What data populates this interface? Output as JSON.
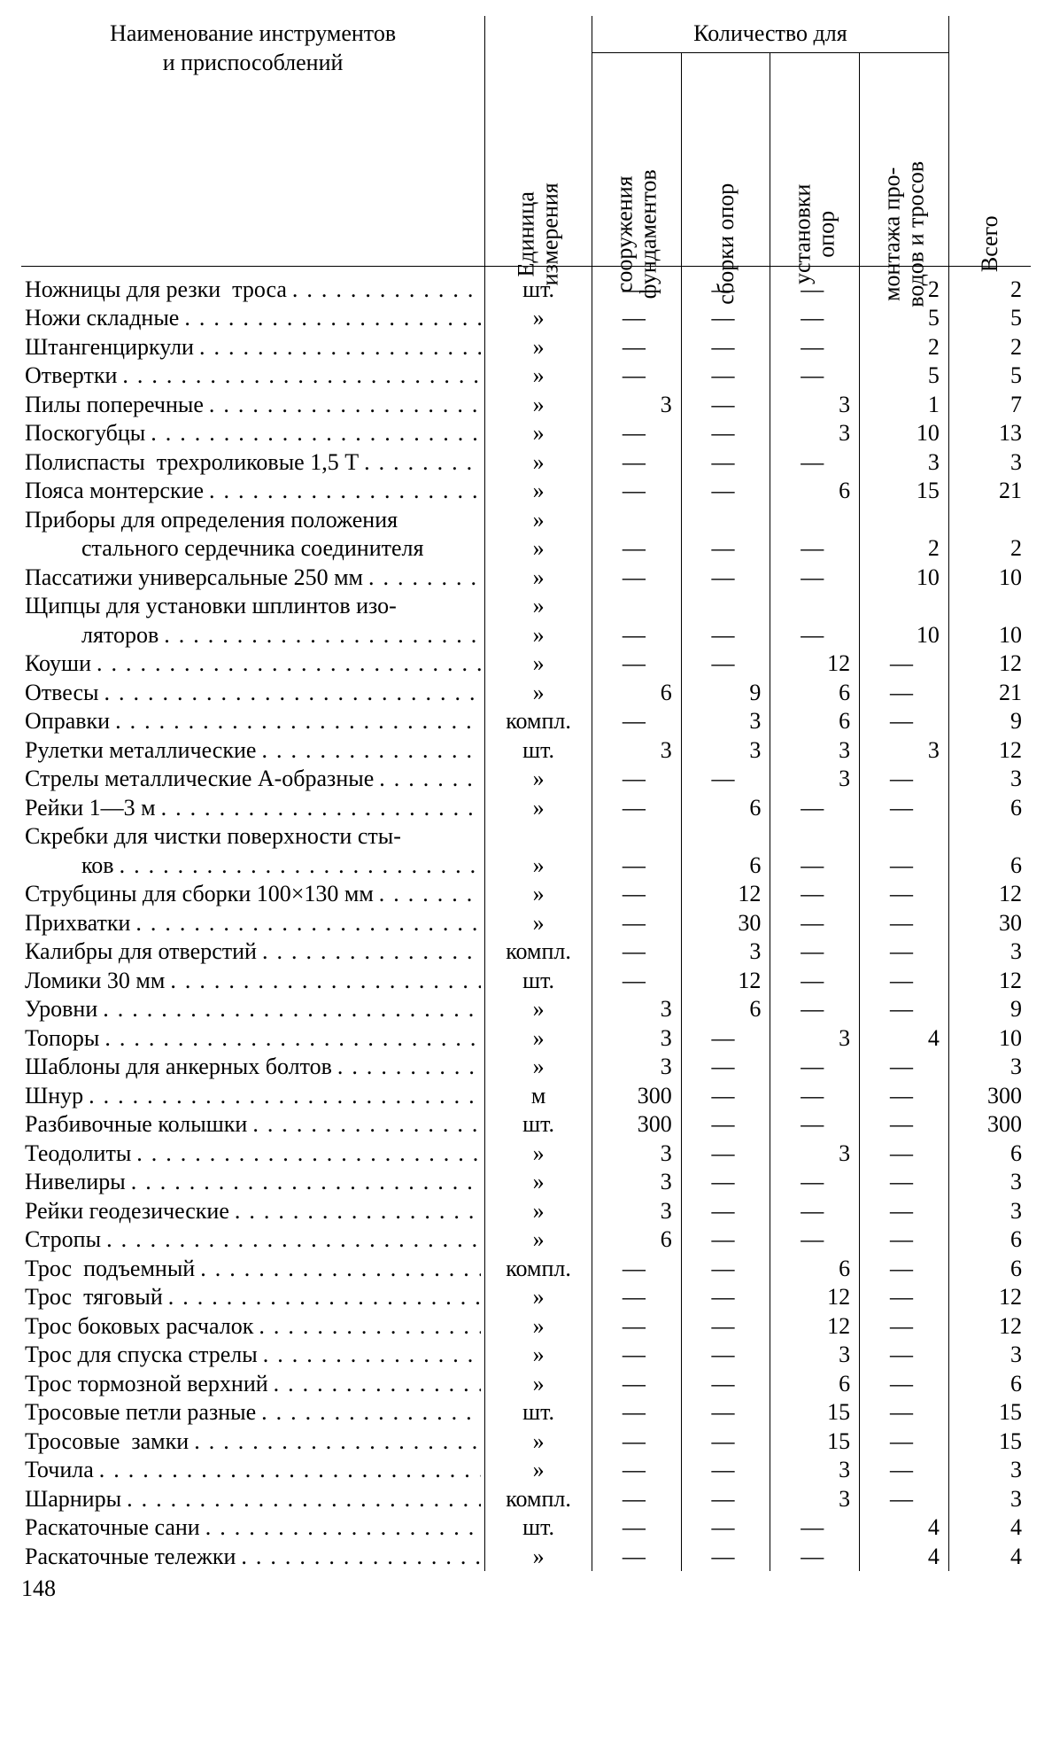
{
  "page_number": "148",
  "header": {
    "name": "Наименование инструментов\nи приспособлений",
    "unit": "Единица\nизмерения",
    "group": "Количество для",
    "cols": [
      "сооружения\nфундаментов",
      "сборки опор",
      "установки\nопор",
      "монтажа про-\nводов и тросов"
    ],
    "total": "Всего"
  },
  "units": {
    "sht": "шт.",
    "ditto": "»",
    "kompl": "компл.",
    "m": "м"
  },
  "rows": [
    {
      "n": "Ножницы для резки  троса",
      "u": "sht",
      "q": [
        "",
        "",
        "",
        "2"
      ],
      "t": "2",
      "dots": true
    },
    {
      "n": "Ножи складные",
      "u": "ditto",
      "q": [
        "",
        "",
        "",
        "5"
      ],
      "t": "5",
      "dots": true
    },
    {
      "n": "Штангенциркули",
      "u": "ditto",
      "q": [
        "",
        "",
        "",
        "2"
      ],
      "t": "2",
      "dots": true
    },
    {
      "n": "Отвертки",
      "u": "ditto",
      "q": [
        "",
        "",
        "",
        "5"
      ],
      "t": "5",
      "dots": true
    },
    {
      "n": "Пилы поперечные",
      "u": "ditto",
      "q": [
        "3",
        "",
        "3",
        "1"
      ],
      "t": "7",
      "dots": true
    },
    {
      "n": "Поскогубцы",
      "u": "ditto",
      "q": [
        "",
        "",
        "3",
        "10"
      ],
      "t": "13",
      "dots": true
    },
    {
      "n": "Полиспасты  трехроликовые 1,5 Т",
      "u": "ditto",
      "q": [
        "",
        "",
        "",
        "3"
      ],
      "t": "3",
      "dots": true
    },
    {
      "n": "Пояса монтерские",
      "u": "ditto",
      "q": [
        "",
        "",
        "6",
        "15"
      ],
      "t": "21",
      "dots": true
    },
    {
      "n": "Приборы для определения положения",
      "u": "ditto",
      "q": [
        null,
        null,
        null,
        null
      ],
      "t": null,
      "dots": false
    },
    {
      "n": "стального сердечника соединителя",
      "indent": true,
      "u": "ditto",
      "q": [
        "",
        "",
        "",
        "2"
      ],
      "t": "2",
      "dots": false
    },
    {
      "n": "Пассатижи универсальные 250 мм",
      "u": "ditto",
      "q": [
        "",
        "",
        "",
        "10"
      ],
      "t": "10",
      "dots": true
    },
    {
      "n": "Щипцы для установки шплинтов изо-",
      "u": "ditto",
      "q": [
        null,
        null,
        null,
        null
      ],
      "t": null,
      "dots": false
    },
    {
      "n": "ляторов",
      "indent": true,
      "u": "ditto",
      "q": [
        "",
        "",
        "",
        "10"
      ],
      "t": "10",
      "dots": true
    },
    {
      "n": "Коуши",
      "u": "ditto",
      "q": [
        "",
        "",
        "12",
        ""
      ],
      "t": "12",
      "dots": true
    },
    {
      "n": "Отвесы",
      "u": "ditto",
      "q": [
        "6",
        "9",
        "6",
        ""
      ],
      "t": "21",
      "dots": true
    },
    {
      "n": "Оправки",
      "u": "kompl",
      "q": [
        "",
        "3",
        "6",
        ""
      ],
      "t": "9",
      "dots": true
    },
    {
      "n": "Рулетки металлические",
      "u": "sht",
      "q": [
        "3",
        "3",
        "3",
        "3"
      ],
      "t": "12",
      "dots": true
    },
    {
      "n": "Стрелы металлические А-образные",
      "u": "ditto",
      "q": [
        "",
        "",
        "3",
        ""
      ],
      "t": "3",
      "dots": true
    },
    {
      "n": "Рейки 1—3 м",
      "u": "ditto",
      "q": [
        "",
        "6",
        "",
        ""
      ],
      "t": "6",
      "dots": true
    },
    {
      "n": "Скребки для чистки поверхности сты-",
      "u": null,
      "q": [
        null,
        null,
        null,
        null
      ],
      "t": null,
      "dots": false
    },
    {
      "n": "ков",
      "indent": true,
      "u": "ditto",
      "q": [
        "",
        "6",
        "",
        ""
      ],
      "t": "6",
      "dots": true
    },
    {
      "n": "Струбцины для сборки 100×130 мм",
      "u": "ditto",
      "q": [
        "",
        "12",
        "",
        ""
      ],
      "t": "12",
      "dots": true
    },
    {
      "n": "Прихватки",
      "u": "ditto",
      "q": [
        "",
        "30",
        "",
        ""
      ],
      "t": "30",
      "dots": true
    },
    {
      "n": "Калибры для отверстий",
      "u": "kompl",
      "q": [
        "",
        "3",
        "",
        ""
      ],
      "t": "3",
      "dots": true
    },
    {
      "n": "Ломики 30 мм",
      "u": "sht",
      "q": [
        "",
        "12",
        "",
        ""
      ],
      "t": "12",
      "dots": true
    },
    {
      "n": "Уровни",
      "u": "ditto",
      "q": [
        "3",
        "6",
        "",
        ""
      ],
      "t": "9",
      "dots": true
    },
    {
      "n": "Топоры",
      "u": "ditto",
      "q": [
        "3",
        "",
        "3",
        "4"
      ],
      "t": "10",
      "dots": true
    },
    {
      "n": "Шаблоны для анкерных болтов",
      "u": "ditto",
      "q": [
        "3",
        "",
        "",
        ""
      ],
      "t": "3",
      "dots": true
    },
    {
      "n": "Шнур",
      "u": "m",
      "q": [
        "300",
        "",
        "",
        ""
      ],
      "t": "300",
      "dots": true
    },
    {
      "n": "Разбивочные колышки",
      "u": "sht",
      "q": [
        "300",
        "",
        "",
        ""
      ],
      "t": "300",
      "dots": true
    },
    {
      "n": "Теодолиты",
      "u": "ditto",
      "q": [
        "3",
        "",
        "3",
        ""
      ],
      "t": "6",
      "dots": true
    },
    {
      "n": "Нивелиры",
      "u": "ditto",
      "q": [
        "3",
        "",
        "",
        ""
      ],
      "t": "3",
      "dots": true
    },
    {
      "n": "Рейки геодезические",
      "u": "ditto",
      "q": [
        "3",
        "",
        "",
        ""
      ],
      "t": "3",
      "dots": true
    },
    {
      "n": "Стропы",
      "u": "ditto",
      "q": [
        "6",
        "",
        "",
        ""
      ],
      "t": "6",
      "dots": true
    },
    {
      "n": "Трос  подъемный",
      "u": "kompl",
      "q": [
        "",
        "",
        "6",
        ""
      ],
      "t": "6",
      "dots": true
    },
    {
      "n": "Трос  тяговый",
      "u": "ditto",
      "q": [
        "",
        "",
        "12",
        ""
      ],
      "t": "12",
      "dots": true
    },
    {
      "n": "Трос боковых расчалок",
      "u": "ditto",
      "q": [
        "",
        "",
        "12",
        ""
      ],
      "t": "12",
      "dots": true
    },
    {
      "n": "Трос для спуска стрелы",
      "u": "ditto",
      "q": [
        "",
        "",
        "3",
        ""
      ],
      "t": "3",
      "dots": true
    },
    {
      "n": "Трос тормозной верхний",
      "u": "ditto",
      "q": [
        "",
        "",
        "6",
        ""
      ],
      "t": "6",
      "dots": true
    },
    {
      "n": "Тросовые петли разные",
      "u": "sht",
      "q": [
        "",
        "",
        "15",
        ""
      ],
      "t": "15",
      "dots": true
    },
    {
      "n": "Тросовые  замки",
      "u": "ditto",
      "q": [
        "",
        "",
        "15",
        ""
      ],
      "t": "15",
      "dots": true
    },
    {
      "n": "Точила",
      "u": "ditto",
      "q": [
        "",
        "",
        "3",
        ""
      ],
      "t": "3",
      "dots": true
    },
    {
      "n": "Шарниры",
      "u": "kompl",
      "q": [
        "",
        "",
        "3",
        ""
      ],
      "t": "3",
      "dots": true
    },
    {
      "n": "Раскаточные сани",
      "u": "sht",
      "q": [
        "",
        "",
        "",
        "4"
      ],
      "t": "4",
      "dots": true
    },
    {
      "n": "Раскаточные тележки",
      "u": "ditto",
      "q": [
        "",
        "",
        "",
        "4"
      ],
      "t": "4",
      "dots": true
    }
  ]
}
